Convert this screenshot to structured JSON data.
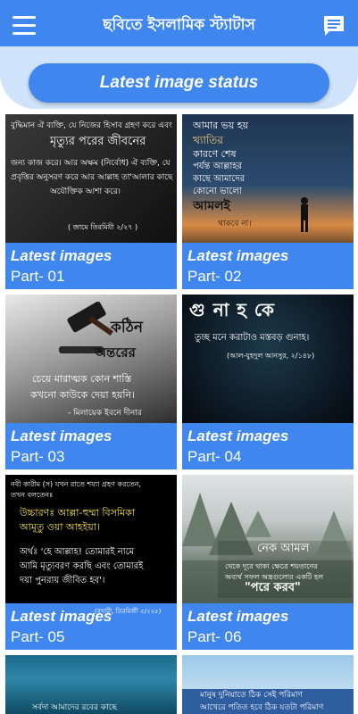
{
  "app": {
    "title": "ছবিতে ইসলামিক স্ট্যাটাস"
  },
  "icons": {
    "menu": "menu-icon",
    "chat": "chat-icon"
  },
  "section": {
    "title": "Latest image status"
  },
  "colors": {
    "primary": "#3f86ee",
    "header_bg": "#cfe3fa"
  },
  "cards": [
    {
      "caption": "Latest images",
      "part": "Part- 01",
      "lines": [
        "বুদ্ধিমান ঐ ব্যক্তি, যে নিজের হিসাব গ্রহণ করে এবং",
        "মৃত্যুর পরের জীবনের",
        "জন্য কাজ করে। আর অক্ষম (নির্বোধ) ঐ ব্যক্তি, যে",
        "প্রবৃত্তির অনুসরণ করে আর আল্লাহ তা'আলার কাছে",
        "অযৌক্তিক আশা করে।",
        "( জামে তিরমিযী ২/২৭ )"
      ]
    },
    {
      "caption": "Latest images",
      "part": "Part- 02",
      "lines": [
        "আমার ভয় হয়",
        "খ্যাতির",
        "কারণে শেষ",
        "পর্যন্ত আল্লাহর",
        "কাছে আমাদের",
        "কোনো ভালো",
        "আমলই",
        "থাকবে না।"
      ]
    },
    {
      "caption": "Latest images",
      "part": "Part- 03",
      "lines": [
        "কঠিন",
        "অন্তরের",
        "চেয়ে মারাত্মক কোন শাস্তি",
        "কখনো কাউকে দেয়া হয়নি।",
        "- মিলায়েক ইবনে দীনার"
      ]
    },
    {
      "caption": "Latest images",
      "part": "Part- 04",
      "lines": [
        "গু না হ কে",
        "তুচ্ছ মনে করাটাও মস্তবড় গুনাহ।",
        "(আল-যুহদুল আনসুর, ২/১৪৮)"
      ]
    },
    {
      "caption": "Latest images",
      "part": "Part- 05",
      "lines": [
        "নবী কারীম (স) যখন রাতে শয্যা গ্রহণ করতেন,",
        "তখন বলতেনঃ",
        "উচ্চারণঃ আল্লা-হুম্মা বিসমিকা",
        "আমূতু ওয়া আহইয়া।",
        "অর্থঃ 'হে আল্লাহ! তোমারই নামে",
        "আমি মৃত্যুবরণ করছি এবং তোমারই",
        "দয়া পুনরায় জীবিত হব'।",
        "(বুখারী, তিরমিজী ৫/২২৫)"
      ]
    },
    {
      "caption": "Latest images",
      "part": "Part- 06",
      "lines": [
        "নেক আমল",
        "থেকে দূরে থাকা ক্ষেত্রে শয়তানের",
        "অব্যর্থ সফল অস্ত্রগুলোর একটি হল",
        "\"পরে করব\""
      ]
    },
    {
      "caption": "",
      "part": "",
      "lines": [
        "সর্বদা আমাদের রবের কাছে"
      ]
    },
    {
      "caption": "",
      "part": "",
      "lines": [
        "মানুষ দুনিয়াতে ঠিক সেই পরিমাণ",
        "আখেরে পতিত হবে ঠিক যতটা পরিমাণ"
      ]
    }
  ]
}
